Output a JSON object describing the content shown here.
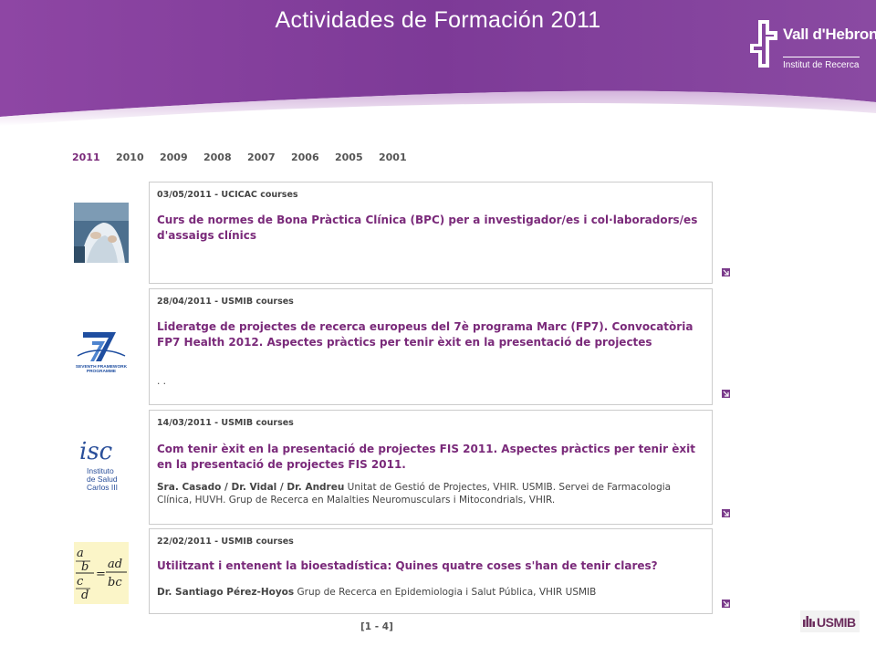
{
  "header": {
    "title": "Actividades de Formación  2011",
    "logo": {
      "name": "Vall d'Hebron",
      "subtitle": "Institut de Recerca"
    }
  },
  "year_tabs": [
    {
      "label": "2011",
      "active": true
    },
    {
      "label": "2010",
      "active": false
    },
    {
      "label": "2009",
      "active": false
    },
    {
      "label": "2008",
      "active": false
    },
    {
      "label": "2007",
      "active": false
    },
    {
      "label": "2006",
      "active": false
    },
    {
      "label": "2005",
      "active": false
    },
    {
      "label": "2001",
      "active": false
    }
  ],
  "news": [
    {
      "meta": "03/05/2011 - UCICAC courses",
      "title": "Curs de normes de Bona Pràctica Clínica (BPC) per a investigador/es i col·laboradors/es d'assaigs clínics",
      "thumb": "lab-photo"
    },
    {
      "meta": "28/04/2011 - USMIB courses",
      "title": "Lideratge de projectes de recerca europeus del 7è programa Marc (FP7). Convocatòria FP7 Health 2012. Aspectes pràctics per tenir èxit en la presentació de projectes",
      "desc": ". .",
      "thumb": "fp7-logo",
      "thumb_text": [
        "SEVENTH FRAMEWORK",
        "PROGRAMME"
      ]
    },
    {
      "meta": "14/03/2011 - USMIB courses",
      "title": "Com tenir èxit en la presentació de projectes FIS 2011. Aspectes pràctics per tenir èxit en la presentació de projectes FIS 2011.",
      "desc_bold": "Sra. Casado / Dr. Vidal / Dr. Andreu",
      "desc": " Unitat de Gestió de Projectes, VHIR. USMIB. Servei de Farmacologia Clínica, HUVH. Grup de Recerca en Malalties Neuromusculars i Mitocondrials, VHIR.",
      "thumb": "isciii-logo",
      "thumb_text": [
        "isc",
        "Instituto",
        "de Salud",
        "Carlos III"
      ]
    },
    {
      "meta": "22/02/2011 - USMIB courses",
      "title": "Utilitzant i entenent la bioestadística: Quines quatre coses s'han de tenir clares?",
      "desc_bold": "Dr. Santiago Pérez-Hoyos",
      "desc": " Grup de Recerca en Epidemiologia i Salut Pública, VHIR USMIB",
      "thumb": "fraction-formula",
      "thumb_text": [
        "a",
        "b",
        "c",
        "d",
        "=",
        "ad",
        "bc"
      ]
    }
  ],
  "pager": "[1 - 4]",
  "footer_logo": "USMIB",
  "colors": {
    "purple": "#8a3f9c",
    "title_purple": "#7a2a7a",
    "arrow_purple": "#7a3a8a"
  }
}
